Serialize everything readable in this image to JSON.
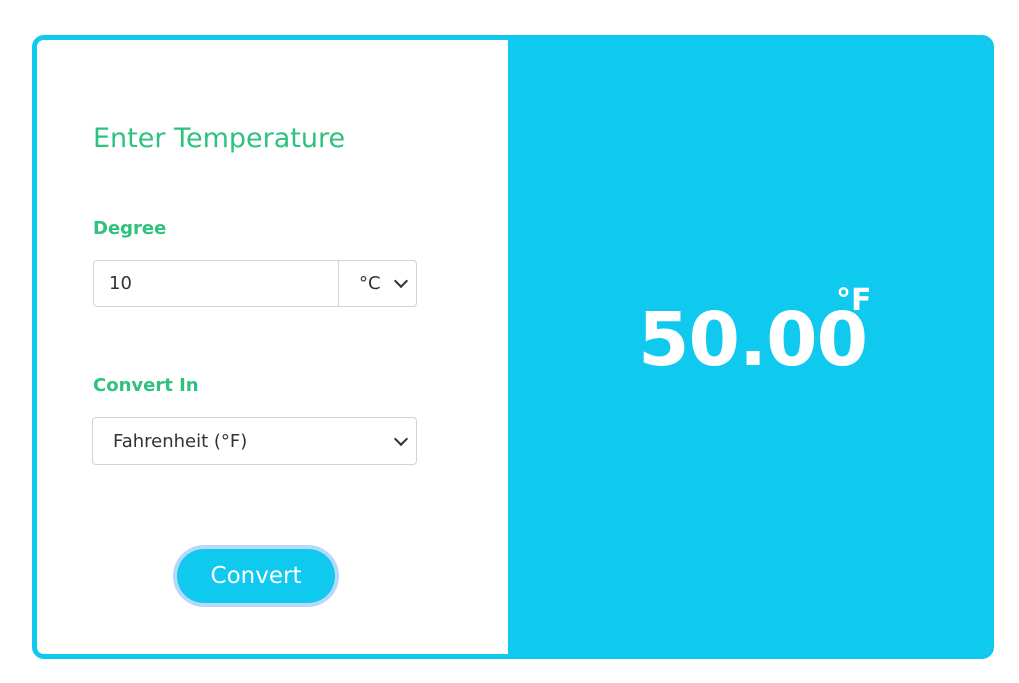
{
  "form": {
    "title": "Enter Temperature",
    "degree_label": "Degree",
    "degree_value": "10",
    "unit_selected": "°C",
    "convert_label": "Convert In",
    "convert_selected": "Fahrenheit (°F)",
    "button_label": "Convert"
  },
  "result": {
    "value": "50.00",
    "unit": "°F"
  },
  "colors": {
    "accent": "#10c9ef",
    "label_green": "#2ec27e"
  }
}
